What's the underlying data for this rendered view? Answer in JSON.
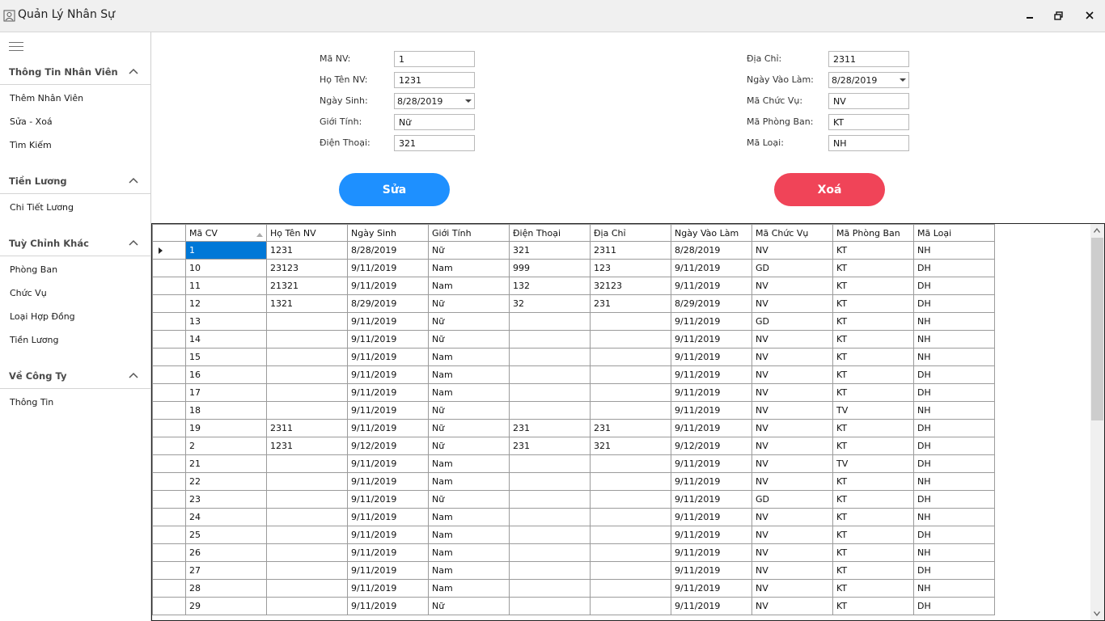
{
  "window": {
    "title": "Quản Lý Nhân Sự"
  },
  "sidebar": {
    "groups": [
      {
        "title": "Thông Tin Nhân Viên",
        "items": [
          "Thêm Nhân Viên",
          "Sửa - Xoá",
          "Tìm Kiếm"
        ]
      },
      {
        "title": "Tiền Lương",
        "items": [
          "Chi Tiết Lương"
        ]
      },
      {
        "title": "Tuỳ Chỉnh Khác",
        "items": [
          "Phòng Ban",
          "Chức Vụ",
          "Loại Hợp Đồng",
          "Tiền Lương"
        ]
      },
      {
        "title": "Về Công Ty",
        "items": [
          "Thông Tin"
        ]
      }
    ]
  },
  "form": {
    "ma_nv": {
      "label": "Mã NV:",
      "value": "1"
    },
    "ho_ten": {
      "label": "Họ Tên NV:",
      "value": "1231"
    },
    "ngay_sinh": {
      "label": "Ngày Sinh:",
      "value": "8/28/2019"
    },
    "gioi_tinh": {
      "label": "Giới Tính:",
      "value": "Nữ"
    },
    "dien_thoai": {
      "label": "Điện Thoại:",
      "value": "321"
    },
    "dia_chi": {
      "label": "Địa Chỉ:",
      "value": "2311"
    },
    "ngay_vao_lam": {
      "label": "Ngày Vào Làm:",
      "value": "8/28/2019"
    },
    "ma_chuc_vu": {
      "label": "Mã Chức Vụ:",
      "value": "NV"
    },
    "ma_phong_ban": {
      "label": "Mã Phòng Ban:",
      "value": "KT"
    },
    "ma_loai": {
      "label": "Mã Loại:",
      "value": "NH"
    }
  },
  "buttons": {
    "edit": "Sửa",
    "delete": "Xoá"
  },
  "grid": {
    "columns": [
      "Mã CV",
      "Họ Tên NV",
      "Ngày Sinh",
      "Giới Tính",
      "Điện Thoại",
      "Địa Chỉ",
      "Ngày Vào Làm",
      "Mã Chức Vụ",
      "Mã Phòng Ban",
      "Mã Loại"
    ],
    "rows": [
      [
        "1",
        "1231",
        "8/28/2019",
        "Nữ",
        "321",
        "2311",
        "8/28/2019",
        "NV",
        "KT",
        "NH"
      ],
      [
        "10",
        "23123",
        "9/11/2019",
        "Nam",
        "999",
        "123",
        "9/11/2019",
        "GD",
        "KT",
        "DH"
      ],
      [
        "11",
        "21321",
        "9/11/2019",
        "Nam",
        "132",
        "32123",
        "9/11/2019",
        "NV",
        "KT",
        "DH"
      ],
      [
        "12",
        "1321",
        "8/29/2019",
        "Nữ",
        "32",
        "231",
        "8/29/2019",
        "NV",
        "KT",
        "DH"
      ],
      [
        "13",
        "",
        "9/11/2019",
        "Nữ",
        "",
        "",
        "9/11/2019",
        "GD",
        "KT",
        "NH"
      ],
      [
        "14",
        "",
        "9/11/2019",
        "Nữ",
        "",
        "",
        "9/11/2019",
        "NV",
        "KT",
        "NH"
      ],
      [
        "15",
        "",
        "9/11/2019",
        "Nam",
        "",
        "",
        "9/11/2019",
        "NV",
        "KT",
        "NH"
      ],
      [
        "16",
        "",
        "9/11/2019",
        "Nam",
        "",
        "",
        "9/11/2019",
        "NV",
        "KT",
        "DH"
      ],
      [
        "17",
        "",
        "9/11/2019",
        "Nam",
        "",
        "",
        "9/11/2019",
        "NV",
        "KT",
        "DH"
      ],
      [
        "18",
        "",
        "9/11/2019",
        "Nữ",
        "",
        "",
        "9/11/2019",
        "NV",
        "TV",
        "NH"
      ],
      [
        "19",
        "2311",
        "9/11/2019",
        "Nữ",
        "231",
        "231",
        "9/11/2019",
        "NV",
        "KT",
        "DH"
      ],
      [
        "2",
        "1231",
        "9/12/2019",
        "Nữ",
        "231",
        "321",
        "9/12/2019",
        "NV",
        "KT",
        "DH"
      ],
      [
        "21",
        "",
        "9/11/2019",
        "Nam",
        "",
        "",
        "9/11/2019",
        "NV",
        "TV",
        "DH"
      ],
      [
        "22",
        "",
        "9/11/2019",
        "Nam",
        "",
        "",
        "9/11/2019",
        "NV",
        "KT",
        "NH"
      ],
      [
        "23",
        "",
        "9/11/2019",
        "Nữ",
        "",
        "",
        "9/11/2019",
        "GD",
        "KT",
        "DH"
      ],
      [
        "24",
        "",
        "9/11/2019",
        "Nam",
        "",
        "",
        "9/11/2019",
        "NV",
        "KT",
        "NH"
      ],
      [
        "25",
        "",
        "9/11/2019",
        "Nam",
        "",
        "",
        "9/11/2019",
        "NV",
        "KT",
        "DH"
      ],
      [
        "26",
        "",
        "9/11/2019",
        "Nam",
        "",
        "",
        "9/11/2019",
        "NV",
        "KT",
        "NH"
      ],
      [
        "27",
        "",
        "9/11/2019",
        "Nam",
        "",
        "",
        "9/11/2019",
        "NV",
        "KT",
        "DH"
      ],
      [
        "28",
        "",
        "9/11/2019",
        "Nam",
        "",
        "",
        "9/11/2019",
        "NV",
        "KT",
        "NH"
      ],
      [
        "29",
        "",
        "9/11/2019",
        "Nữ",
        "",
        "",
        "9/11/2019",
        "NV",
        "KT",
        "DH"
      ]
    ]
  },
  "colors": {
    "edit_button": "#1e90ff",
    "delete_button": "#f04458",
    "selection": "#0078d7"
  }
}
